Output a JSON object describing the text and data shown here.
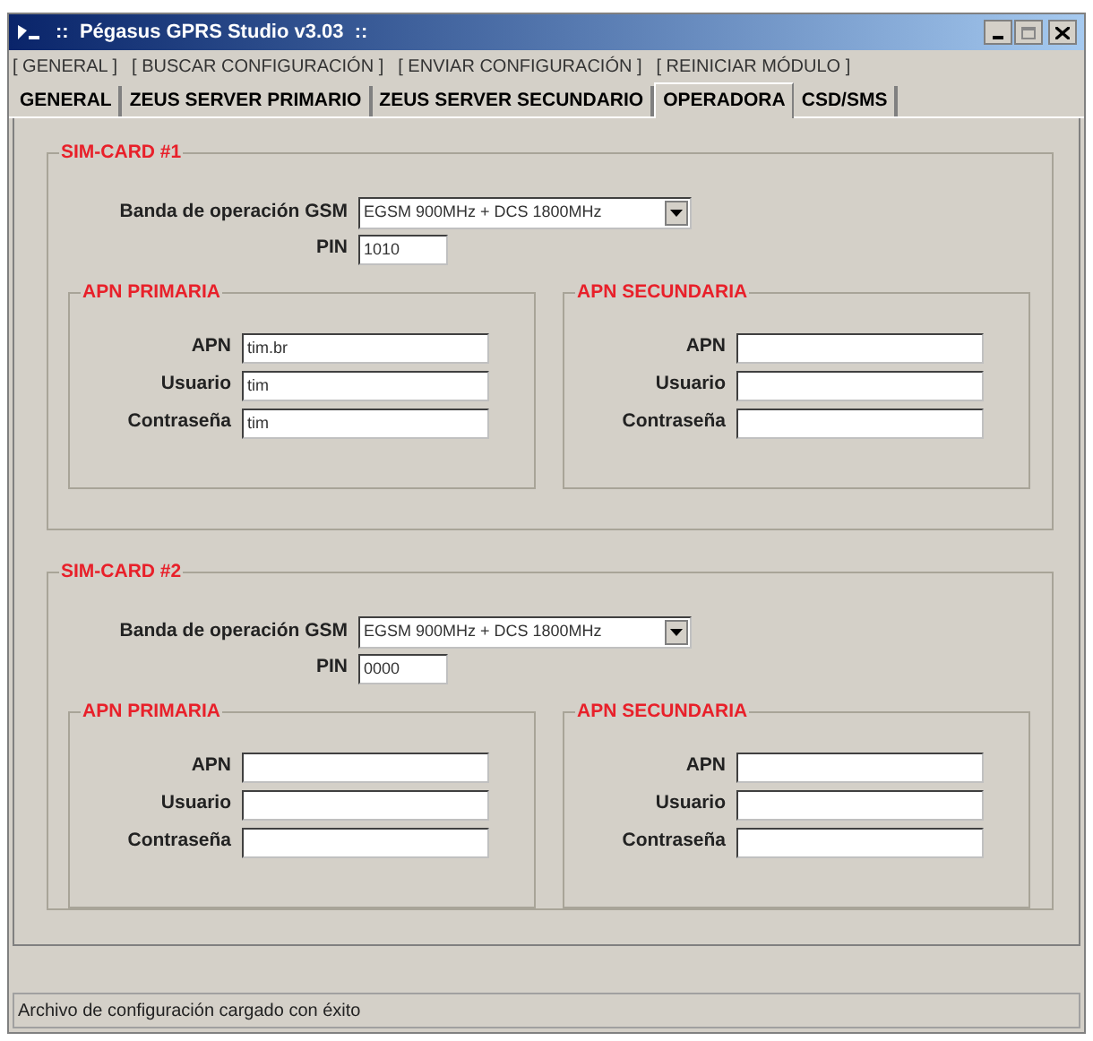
{
  "window": {
    "title": "::  Pégasus GPRS Studio v3.03  ::"
  },
  "menu": [
    "[ GENERAL ]",
    "[ BUSCAR CONFIGURACIÓN ]",
    "[ ENVIAR CONFIGURACIÓN ]",
    "[ REINICIAR MÓDULO ]"
  ],
  "tabs": [
    {
      "label": "GENERAL",
      "selected": false
    },
    {
      "label": "ZEUS SERVER PRIMARIO",
      "selected": false
    },
    {
      "label": "ZEUS SERVER SECUNDARIO",
      "selected": false
    },
    {
      "label": "OPERADORA",
      "selected": true
    },
    {
      "label": "CSD/SMS",
      "selected": false
    }
  ],
  "sim_cards": [
    {
      "title": "SIM-CARD #1",
      "band_label": "Banda de operación GSM",
      "band_value": "EGSM 900MHz + DCS 1800MHz",
      "pin_label": "PIN",
      "pin_value": "1010",
      "apn_groups": [
        {
          "title": "APN PRIMARIA",
          "fields": [
            {
              "label": "APN",
              "value": "tim.br"
            },
            {
              "label": "Usuario",
              "value": "tim"
            },
            {
              "label": "Contraseña",
              "value": "tim"
            }
          ]
        },
        {
          "title": "APN SECUNDARIA",
          "fields": [
            {
              "label": "APN"
            },
            {
              "label": "Usuario"
            },
            {
              "label": "Contraseña"
            }
          ]
        }
      ]
    },
    {
      "title": "SIM-CARD #2",
      "band_label": "Banda de operación GSM",
      "band_value": "EGSM 900MHz + DCS 1800MHz",
      "pin_label": "PIN",
      "pin_value": "0000",
      "apn_groups": [
        {
          "title": "APN PRIMARIA",
          "fields": [
            {
              "label": "APN"
            },
            {
              "label": "Usuario"
            },
            {
              "label": "Contraseña"
            }
          ]
        },
        {
          "title": "APN SECUNDARIA",
          "fields": [
            {
              "label": "APN"
            },
            {
              "label": "Usuario"
            },
            {
              "label": "Contraseña"
            }
          ]
        }
      ]
    }
  ],
  "status_bar": "Archivo de configuración cargado con éxito"
}
